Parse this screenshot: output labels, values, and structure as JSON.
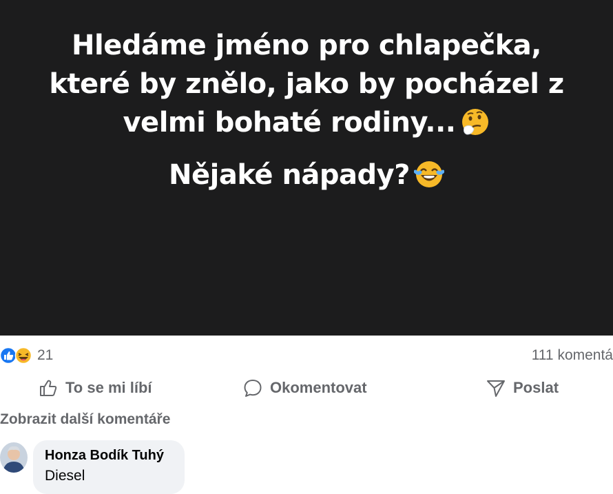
{
  "post": {
    "text_line1": "Hledáme jméno pro chlapečka, které by znělo, jako by pocházel z velmi bohaté rodiny...",
    "text_line2": "Nějaké nápady?",
    "emoji1": "thinking-face",
    "emoji2": "tears-of-joy-face",
    "background": "#1c1c1d"
  },
  "engagement": {
    "reaction_icons": [
      "like",
      "haha"
    ],
    "reaction_count": "21",
    "comment_count": "111 komentá"
  },
  "actions": {
    "like_label": "To se mi líbí",
    "comment_label": "Okomentovat",
    "share_label": "Poslat"
  },
  "comments": {
    "more_label": "Zobrazit další komentáře",
    "items": [
      {
        "author": "Honza Bodík Tuhý",
        "text": "Diesel"
      }
    ]
  },
  "colors": {
    "muted": "#65676b",
    "like_blue": "#1877f2",
    "bubble": "#f0f2f5"
  }
}
